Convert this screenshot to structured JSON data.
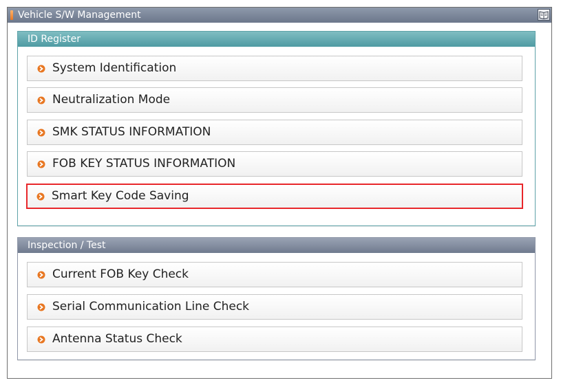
{
  "window": {
    "title": "Vehicle S/W Management",
    "help_icon": "help-book-icon"
  },
  "id_register": {
    "header": "ID Register",
    "items": [
      {
        "label": "System Identification",
        "icon": "orange-arrow-bullet-icon",
        "selected": false
      },
      {
        "label": "Neutralization Mode",
        "icon": "orange-arrow-bullet-icon",
        "selected": false
      },
      {
        "label": "SMK STATUS INFORMATION",
        "icon": "orange-arrow-bullet-icon",
        "selected": false
      },
      {
        "label": "FOB KEY STATUS INFORMATION",
        "icon": "orange-arrow-bullet-icon",
        "selected": false
      },
      {
        "label": "Smart Key Code Saving",
        "icon": "orange-arrow-bullet-icon",
        "selected": true
      }
    ]
  },
  "inspection_test": {
    "header": "Inspection / Test",
    "items": [
      {
        "label": "Current FOB Key Check",
        "icon": "orange-arrow-bullet-icon"
      },
      {
        "label": "Serial Communication Line Check",
        "icon": "orange-arrow-bullet-icon"
      },
      {
        "label": "Antenna Status Check",
        "icon": "orange-arrow-bullet-icon"
      }
    ]
  },
  "colors": {
    "accent_orange": "#e87722",
    "selection_red": "#e8262a",
    "id_register_header": "#4f9ba3",
    "inspection_header": "#6f7a8e",
    "titlebar": "#6c778b"
  }
}
